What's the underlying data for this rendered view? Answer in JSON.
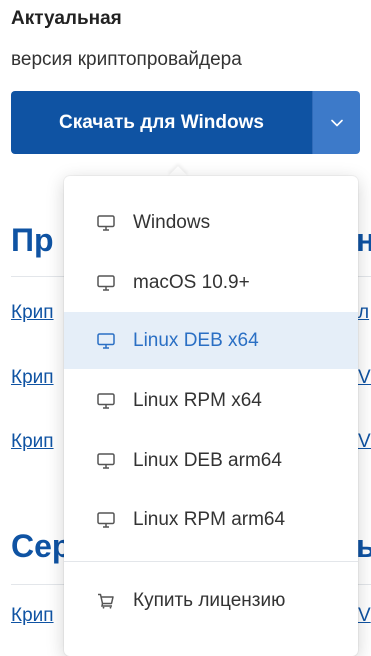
{
  "header": {
    "title": "Актуальная",
    "subtitle": "версия криптопровайдера"
  },
  "download": {
    "button_label": "Скачать для Windows"
  },
  "background": {
    "section1_heading_visible": "Пр",
    "section1_heading_right": "н",
    "section2_heading_visible": "Сер",
    "section2_heading_right": "ы",
    "link_fragment_left": "Крип",
    "link_fragment_right_1": "л",
    "link_fragment_right_2": "Vi",
    "link_fragment_right_3": "Vi",
    "link_fragment_right_4": "V"
  },
  "dropdown": {
    "items": [
      {
        "label": "Windows",
        "icon": "monitor-icon",
        "active": false
      },
      {
        "label": "macOS 10.9+",
        "icon": "monitor-icon",
        "active": false
      },
      {
        "label": "Linux DEB x64",
        "icon": "monitor-icon",
        "active": true
      },
      {
        "label": "Linux RPM x64",
        "icon": "monitor-icon",
        "active": false
      },
      {
        "label": "Linux DEB arm64",
        "icon": "monitor-icon",
        "active": false
      },
      {
        "label": "Linux RPM arm64",
        "icon": "monitor-icon",
        "active": false
      }
    ],
    "buy_label": "Купить лицензию",
    "buy_icon": "cart-icon"
  },
  "colors": {
    "primary": "#0f53a3",
    "toggle": "#3d7ac9",
    "active_bg": "#e5eef8",
    "active_text": "#2a6fc4"
  }
}
